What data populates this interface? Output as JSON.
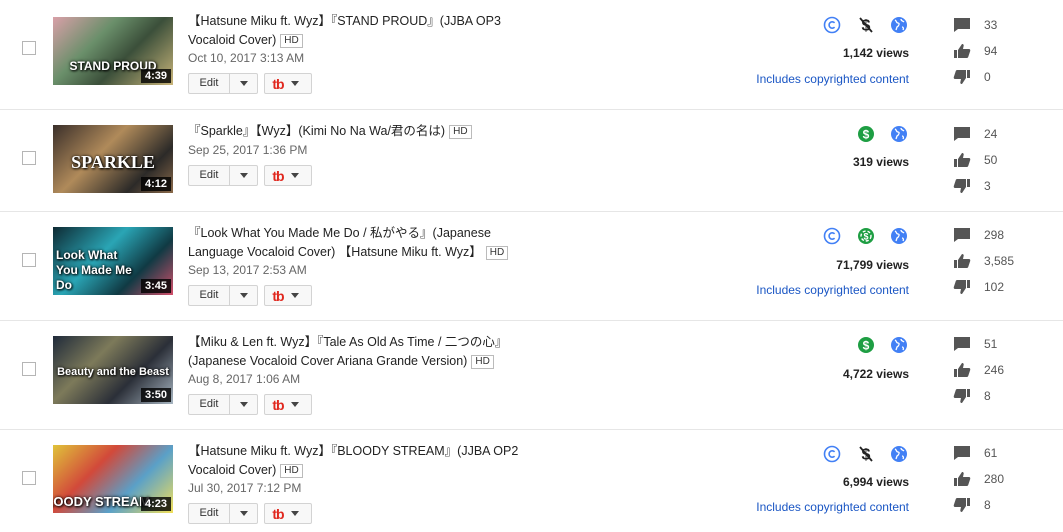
{
  "colors": {
    "accent_blue": "#4280f5",
    "monetized_green": "#1e9e43",
    "link_blue": "#1a56c4",
    "brand_red": "#e0281e"
  },
  "actions": {
    "edit_label": "Edit",
    "tb_label": "tb"
  },
  "videos": [
    {
      "title": "【Hatsune Miku ft. Wyz】『STAND PROUD』(JJBA OP3 Vocaloid Cover)",
      "hd": "HD",
      "date": "Oct 10, 2017 3:13 AM",
      "thumb_caption": "STAND PROUD",
      "duration": "4:39",
      "views": "1,142 views",
      "copyright": "Includes copyrighted content",
      "comments": "33",
      "likes": "94",
      "dislikes": "0",
      "icons": [
        "copyright-icon",
        "not-monetized-icon",
        "public-globe-icon"
      ]
    },
    {
      "title": "『Sparkle』【Wyz】(Kimi No Na Wa/君の名は)",
      "hd": "HD",
      "date": "Sep 25, 2017 1:36 PM",
      "thumb_caption": "SPARKLE",
      "duration": "4:12",
      "views": "319 views",
      "copyright": "",
      "comments": "24",
      "likes": "50",
      "dislikes": "3",
      "icons": [
        "monetized-icon",
        "public-globe-icon"
      ]
    },
    {
      "title": "『Look What You Made Me Do / 私がやる』(Japanese Language Vocaloid Cover) 【Hatsune Miku ft. Wyz】",
      "hd": "HD",
      "date": "Sep 13, 2017 2:53 AM",
      "thumb_caption": "Look What You Made Me Do",
      "duration": "3:45",
      "views": "71,799 views",
      "copyright": "Includes copyrighted content",
      "comments": "298",
      "likes": "3,585",
      "dislikes": "102",
      "icons": [
        "copyright-icon",
        "monetized-limited-icon",
        "public-globe-icon"
      ]
    },
    {
      "title": "【Miku & Len ft. Wyz】『Tale As Old As Time / 二つの心』(Japanese Vocaloid Cover Ariana Grande Version)",
      "hd": "HD",
      "date": "Aug 8, 2017 1:06 AM",
      "thumb_caption": "Beauty and the Beast",
      "duration": "3:50",
      "views": "4,722 views",
      "copyright": "",
      "comments": "51",
      "likes": "246",
      "dislikes": "8",
      "icons": [
        "monetized-icon",
        "public-globe-icon"
      ]
    },
    {
      "title": "【Hatsune Miku ft. Wyz】『BLOODY STREAM』(JJBA OP2 Vocaloid Cover)",
      "hd": "HD",
      "date": "Jul 30, 2017 7:12 PM",
      "thumb_caption": "BLOODY STREAM",
      "duration": "4:23",
      "views": "6,994 views",
      "copyright": "Includes copyrighted content",
      "comments": "61",
      "likes": "280",
      "dislikes": "8",
      "icons": [
        "copyright-icon",
        "not-monetized-icon",
        "public-globe-icon"
      ]
    }
  ]
}
